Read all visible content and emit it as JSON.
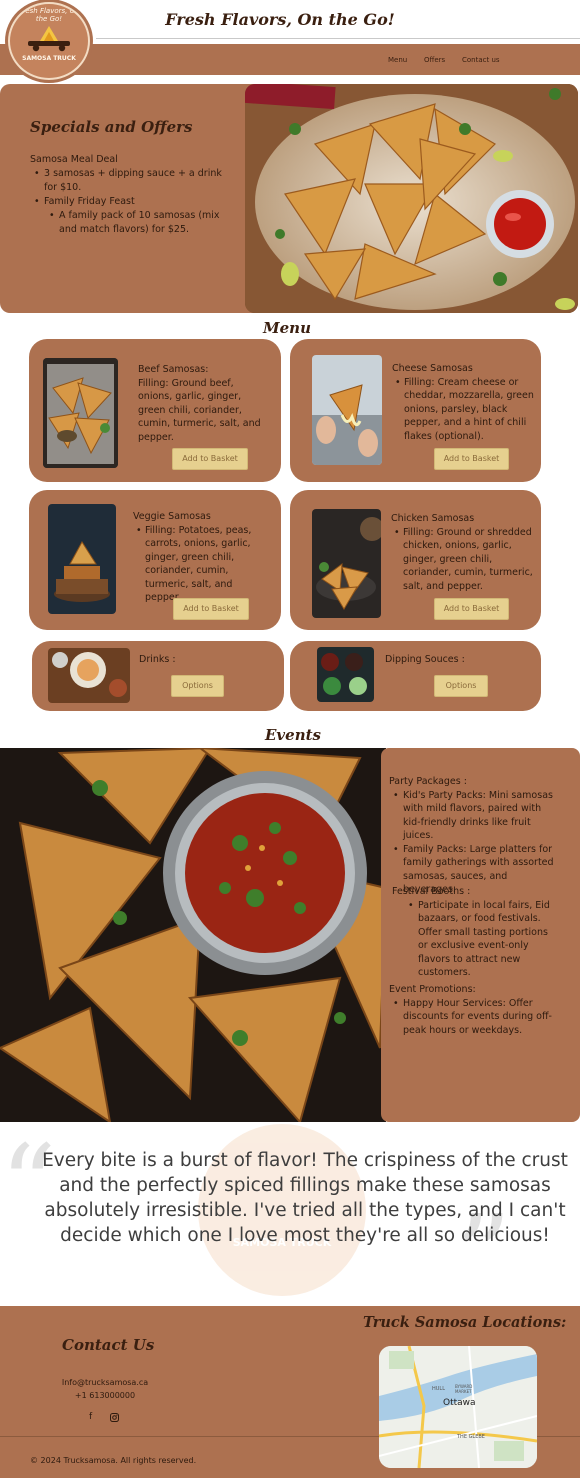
{
  "header": {
    "logo_arc_text": "Fresh Flavors, On the Go!",
    "logo_name": "SAMOSA TRUCK",
    "site_title": "Fresh Flavors, On the Go!",
    "nav": [
      "Menu",
      "Offers",
      "Contact us"
    ]
  },
  "specials": {
    "title": "Specials and Offers",
    "deal_title": "Samosa Meal Deal",
    "deal_item": "3 samosas + dipping sauce + a drink for $10.",
    "feast_title": "Family Friday Feast",
    "feast_item": "A family pack of 10 samosas (mix and match flavors) for $25."
  },
  "menu": {
    "title": "Menu",
    "add_label": "Add to Basket",
    "options_label": "Options",
    "beef": {
      "name": "Beef Samosas:",
      "filling": "Filling: Ground beef, onions, garlic, ginger, green chili, coriander, cumin, turmeric, salt, and pepper."
    },
    "cheese": {
      "name": "Cheese Samosas",
      "filling": "Filling: Cream cheese or cheddar, mozzarella, green onions, parsley, black pepper, and a hint of chili flakes (optional)."
    },
    "veggie": {
      "name": "Veggie Samosas",
      "filling": "Filling: Potatoes, peas, carrots, onions, garlic, ginger, green chili, coriander, cumin, turmeric, salt, and pepper."
    },
    "chicken": {
      "name": "Chicken Samosas",
      "filling": "Filling: Ground or shredded chicken, onions, garlic, ginger, green chili, coriander, cumin, turmeric, salt, and pepper."
    },
    "drinks": "Drinks :",
    "sauces": "Dipping Souces :"
  },
  "events": {
    "title": "Events",
    "party_title": "Party Packages :",
    "party_items": [
      "Kid's Party Packs: Mini samosas with mild flavors, paired with kid-friendly drinks like fruit juices.",
      "Family Packs: Large platters for family gatherings with assorted samosas, sauces, and beverages."
    ],
    "festival_title": "Festival Booths :",
    "festival_item": "Participate in local fairs, Eid bazaars, or food festivals. Offer small tasting portions or exclusive event-only flavors to attract new customers.",
    "promo_title": "Event Promotions:",
    "promo_item": "Happy Hour Services: Offer discounts for events during off-peak hours or weekdays."
  },
  "testimonial": {
    "text": "Every bite is a burst of flavor! The crispiness of the crust and the perfectly spiced fillings make these samosas absolutely irresistible. I've tried all the types, and I can't decide which one I love most they're all so delicious!",
    "watermark": "SAMOSA TRUCK"
  },
  "footer": {
    "contact_title": "Contact Us",
    "email": "Info@trucksamosa.ca",
    "phone": "+1 613000000",
    "facebook_glyph": "f",
    "locations_title": "Truck Samosa Locations:",
    "map_city": "Ottawa",
    "map_hull": "HULL",
    "map_byward": "BYWARD MARKET",
    "map_glebe": "THE GLEBE",
    "copyright": "© 2024 Trucksamosa. All rights reserved."
  },
  "colors": {
    "brand_brown": "#ad7150",
    "button_yellow": "#e6d08f",
    "title_dark": "#3a1f10"
  },
  "icons": [
    "facebook-icon",
    "instagram-icon",
    "truck-icon"
  ]
}
